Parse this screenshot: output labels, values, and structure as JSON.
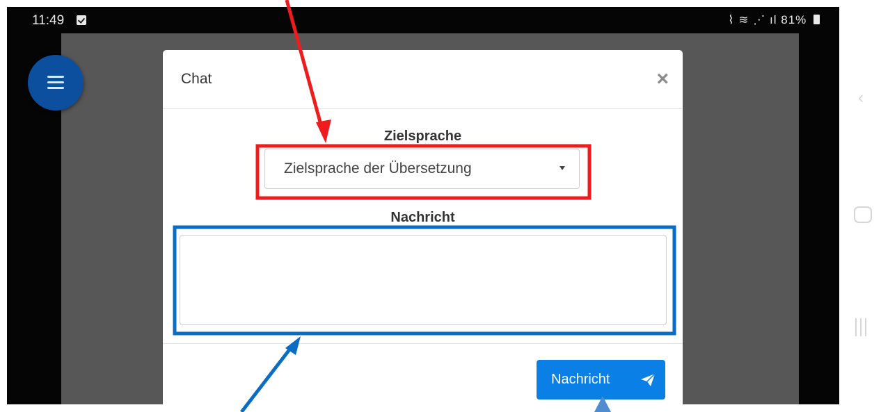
{
  "status_bar": {
    "time": "11:49",
    "signal_text": "↗︎ ≈ ↗︎ .▏",
    "battery": "81%"
  },
  "modal": {
    "title": "Chat",
    "close_label": "×",
    "target_language_label": "Zielsprache",
    "target_language_select": "Zielsprache der Übersetzung",
    "message_label": "Nachricht",
    "message_value": "",
    "send_button_label": "Nachricht"
  },
  "colors": {
    "annotation_red": "#ee1c1c",
    "annotation_blue": "#0a6cc2",
    "primary_button": "#0a7fe5",
    "menu_fab": "#0d4f9f"
  },
  "icons": {
    "menu": "hamburger-icon",
    "close": "close-icon",
    "select": "caret-down-icon",
    "send": "paper-plane-icon"
  }
}
